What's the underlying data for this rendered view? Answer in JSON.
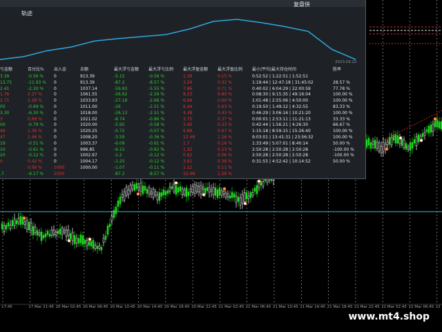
{
  "panel": {
    "title": "复盘侠",
    "equity_tab": "轨迹",
    "equity_date": "2023.03.22",
    "equity_curve": [
      0.0,
      0.07,
      0.22,
      0.31,
      0.46,
      0.52,
      0.57,
      0.62,
      0.76,
      0.95,
      1.0,
      0.92,
      0.82,
      0.7,
      0.25,
      0.0
    ],
    "line_color": "#2fa9e0"
  },
  "table": {
    "headers": [
      "亏金额",
      "百分比%",
      "出入金",
      "余额",
      "最大浮亏金额",
      "最大浮亏比例",
      "最大浮盈金额",
      "最大浮盈比例",
      "最小|平均|最大持仓时间",
      "胜率"
    ],
    "rows": [
      [
        "3.39",
        "-0.56 %",
        "0",
        "913.39",
        "-5.15",
        "-0.56 %",
        "1.39",
        "0.15 %",
        "0:52:52 | 1:22:51 | 1:52:51",
        ""
      ],
      [
        "13.75",
        "-11.93 %",
        "0",
        "913.39",
        "-87.2",
        "-8.57 %",
        "3.24",
        "0.32 %",
        "1:19:44 | 12:47:18 | 31:45:02",
        "28.57 %"
      ],
      [
        "2.41",
        "-2.30 %",
        "0",
        "1037.14",
        "-59.83",
        "-5.55 %",
        "7.86",
        "0.71 %",
        "0:40:02 | 6:04:29 | 22:00:59",
        "77.78 %"
      ],
      [
        "1.76",
        "2.37 %",
        "0",
        "1061.55",
        "-26.62",
        "-2.56 %",
        "8.23",
        "0.80 %",
        "0:08:30 | 9:15:35 | 49:16:04",
        "100.00 %"
      ],
      [
        "2.71",
        "2.28 %",
        "0",
        "1033.93",
        "-27.18",
        "-2.66 %",
        "6.66",
        "0.60 %",
        "1:01:48 | 2:55:06 | 4:50:00",
        "100.00 %"
      ],
      [
        "00",
        "-0.69 %",
        "0",
        "1011.00",
        "-26",
        "-2.51 %",
        "6.44",
        "0.63 %",
        "0:19:50 | 1:49:12 | 4:32:55",
        "83.33 %"
      ],
      [
        "3.30",
        "-6.30 %",
        "0",
        "1018.00",
        "-26.13",
        "-2.51 %",
        "4.38",
        "0.43 %",
        "0:46:29 | 3:06:16 | 10:21:20",
        "100.00 %"
      ],
      [
        "3",
        "0.69 %",
        "0",
        "1021.02",
        "-8.74",
        "-0.86 %",
        "3.75",
        "0.37 %",
        "0:00:01 | 2:53:11 | 11:21:13",
        "33.33 %"
      ],
      [
        "00",
        "-0.79 %",
        "0",
        "1020.00",
        "-5.95",
        "-0.58 %",
        "3.40",
        "0.33 %",
        "0:42:44 | 1:56:21 | 4:26:30",
        "66.67 %"
      ],
      [
        "46",
        "1.36 %",
        "0",
        "1020.25",
        "-0.72",
        "-0.07 %",
        "6.86",
        "0.67 %",
        "1:15:18 | 8:59:15 | 15:26:40",
        "100.00 %"
      ],
      [
        "47",
        "1.46 %",
        "0",
        "1008.20",
        "-3.59",
        "-0.36 %",
        "12.48",
        "1.26 %",
        "9:03:01 | 13:41:31 | 23:56:32",
        "100.00 %"
      ],
      [
        "19",
        "-0.51 %",
        "0",
        "1003.37",
        "-6.09",
        "-0.61 %",
        "1.7",
        "0.16 %",
        "1:33:49 | 5:07:01 | 8:40:14",
        "50.00 %"
      ],
      [
        "10",
        "-0.61 %",
        "0",
        "996.85",
        "-6.15",
        "-0.62 %",
        "1.32",
        "0.13 %",
        "2:50:28 | 2:50:28 | 2:50:28",
        "-100.00 %"
      ],
      [
        "20",
        "-0.12 %",
        "0",
        "1002.97",
        "-1.2",
        "-0.12 %",
        "0.62",
        "0.06 %",
        "2:50:28 | 2:50:28 | 2:50:28",
        "-100.00 %"
      ],
      [
        "0",
        "0.42 %",
        "0",
        "1004.17",
        "-1.25",
        "-0.12 %",
        "3.61",
        "0.36 %",
        "0:31:55 | 4:52:42 | 10:14:52",
        "50.00 %"
      ],
      [
        "",
        "0.00 %",
        "1000",
        "1000.00",
        "-1.07",
        "-0.11 %",
        "1.12",
        "0.11 %",
        "",
        ""
      ],
      [
        ".7",
        "-9.17 %",
        "1000",
        "",
        "-87.2",
        "-8.57 %",
        "12.48",
        "1.26 %",
        "",
        ""
      ]
    ],
    "colors": {
      "header": "#cfd6dd",
      "white": "#e7ecf1",
      "green": "#2ccf2c",
      "red": "#e43030"
    }
  },
  "time_axis": [
    "17:45",
    "17 Mar 21:45",
    "20 Mar 02:45",
    "20 Mar 06:45",
    "20 Mar 10:45",
    "20 Mar 14:45",
    "20 Mar 18:45",
    "20 Mar 22:45",
    "21 Mar 02:45",
    "21 Mar 06:45",
    "21 Mar 10:45",
    "21 Mar 14:45",
    "21 Mar 18:45",
    "21 Mar 22:45",
    "22 Mar 02:45",
    "22 Mar 06:45",
    "22 Mar 10:45"
  ],
  "watermark": "www.mt4.shop",
  "chart_colors": {
    "bull": "#1fdc1f",
    "bear": "#ffffff",
    "grid": "#c8c8c8",
    "level": "#39c6d6",
    "stop": "#d12a2a"
  }
}
